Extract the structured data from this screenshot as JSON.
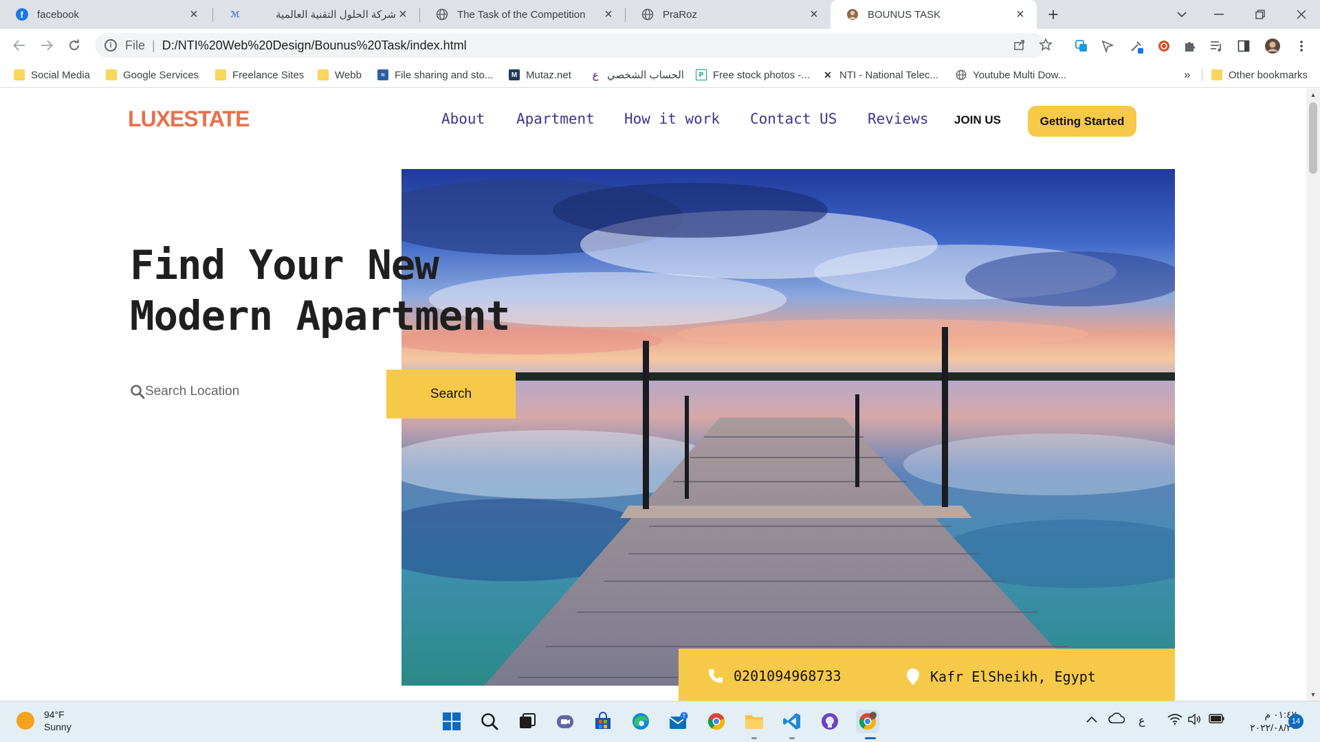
{
  "browser": {
    "tabs": [
      {
        "title": "facebook",
        "icon": "facebook-icon",
        "active": false
      },
      {
        "title": "شركة الحلول التقنية العالمية",
        "icon": "site-logo-icon",
        "active": false
      },
      {
        "title": "The Task of the Competition",
        "icon": "globe-icon",
        "active": false
      },
      {
        "title": "PraRoz",
        "icon": "globe-icon",
        "active": false
      },
      {
        "title": "BOUNUS TASK",
        "icon": "site-avatar-icon",
        "active": true
      }
    ],
    "address": {
      "scheme": "File",
      "url": "D:/NTI%20Web%20Design/Bounus%20Task/index.html"
    },
    "bookmarks": [
      {
        "label": "Social Media",
        "icon": "folder-icon"
      },
      {
        "label": "Google Services",
        "icon": "folder-icon"
      },
      {
        "label": "Freelance Sites",
        "icon": "folder-icon"
      },
      {
        "label": "Webb",
        "icon": "folder-icon"
      },
      {
        "label": "File sharing and sto...",
        "icon": "file-sharing-icon"
      },
      {
        "label": "Mutaz.net",
        "icon": "mutaz-icon"
      },
      {
        "label": "الحساب الشخصي",
        "icon": "profile-icon"
      },
      {
        "label": "Free stock photos -...",
        "icon": "stock-photos-icon"
      },
      {
        "label": "NTI - National Telec...",
        "icon": "nti-icon"
      },
      {
        "label": "Youtube Multi Dow...",
        "icon": "globe-icon"
      }
    ],
    "more_bookmarks": "»",
    "other_bookmarks": "Other bookmarks"
  },
  "page": {
    "logo": {
      "part1": "LUX",
      "part2": "ESTATE"
    },
    "nav": [
      "About",
      "Apartment",
      "How it work",
      "Contact US",
      "Reviews"
    ],
    "join": "JOIN US",
    "cta": "Getting Started",
    "headline": {
      "line1": "Find Your New",
      "line2": "Modern Apartment"
    },
    "search": {
      "placeholder": "Search Location",
      "button": "Search"
    },
    "contact": {
      "phone": "0201094968733",
      "location": "Kafr ElSheikh, Egypt"
    },
    "colors": {
      "accent": "#f7c948",
      "nav": "#3f3490",
      "logo": "#e8704b"
    }
  },
  "taskbar": {
    "weather": {
      "temp": "94°F",
      "condition": "Sunny"
    },
    "language": "ع",
    "clock": {
      "time": "٠١:٤٧ م",
      "date": "٢٠٢٢/٠٨/٢٠"
    },
    "notifications": "14",
    "mail_badge": "T"
  }
}
